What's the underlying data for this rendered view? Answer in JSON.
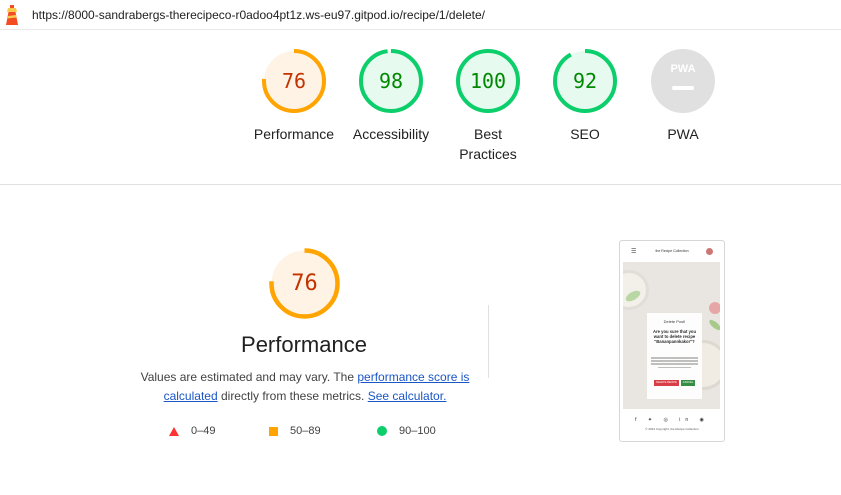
{
  "colors": {
    "orange": "#ffa400",
    "orange_fill": "#fff3e6",
    "orange_text": "#c33300",
    "green": "#0cce6b",
    "green_fill": "#e6faef",
    "green_text": "#008800",
    "grey": "#e0e0e0",
    "red": "#ff3333",
    "link": "#1a56c5"
  },
  "address_bar": {
    "icon": "lighthouse-icon",
    "url": "https://8000-sandrabergs-therecipeco-r0adoo4pt1z.ws-eu97.gitpod.io/recipe/1/delete/"
  },
  "scores": [
    {
      "label": "Performance",
      "score": "76",
      "fraction": 0.76,
      "rating": "average"
    },
    {
      "label": "Accessibility",
      "score": "98",
      "fraction": 0.98,
      "rating": "pass"
    },
    {
      "label": "Best Practices",
      "score": "100",
      "fraction": 1.0,
      "rating": "pass"
    },
    {
      "label": "SEO",
      "score": "92",
      "fraction": 0.92,
      "rating": "pass"
    },
    {
      "label": "PWA",
      "score": "",
      "fraction": 0,
      "rating": "na",
      "badge": "PWA"
    }
  ],
  "performance": {
    "score": "76",
    "fraction": 0.76,
    "title": "Performance",
    "desc_prefix": "Values are estimated and may vary. The ",
    "desc_link1": "performance score is calculated",
    "desc_middle": " directly from these metrics. ",
    "desc_link2": "See calculator."
  },
  "legend": [
    {
      "range": "0–49",
      "icon": "triangle-icon"
    },
    {
      "range": "50–89",
      "icon": "square-icon"
    },
    {
      "range": "90–100",
      "icon": "circle-icon"
    }
  ],
  "screenshot": {
    "brand": "the Recipe Collection",
    "card_title": "Delete Post!",
    "card_question": "Are you sure that you want to delete recipe \"Bananpannkakor\"?",
    "delete_btn": "DELETE RECIPE",
    "cancel_btn": "CANCEL",
    "social": "f ✦ ◎ in ◉",
    "copyright": "© 2023 Copyright: the Recipe Collection"
  }
}
